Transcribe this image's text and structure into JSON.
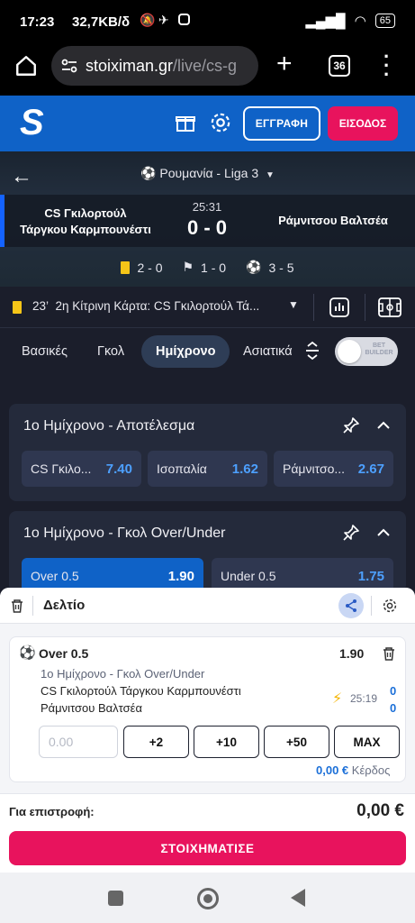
{
  "status_bar": {
    "time": "17:23",
    "speed": "32,7KB/δ",
    "battery": "65"
  },
  "browser": {
    "host": "stoiximan.gr",
    "path": "/live/cs-g",
    "tab_count": "36"
  },
  "header": {
    "logo": "S",
    "register_label": "ΕΓΓΡΑΦΗ",
    "login_label": "ΕΙΣΟΔΟΣ"
  },
  "match": {
    "league": "Ρουμανία - Liga 3",
    "home_team_line1": "CS Γκιλορτούλ",
    "home_team_line2": "Τάργκου Καρμπουνέστι",
    "away_team": "Ράμνιτσου Βαλτσέα",
    "clock": "25:31",
    "score": "0 - 0",
    "stats": {
      "yellow_cards": "2 - 0",
      "corners": "1 - 0",
      "shots": "3 - 5"
    }
  },
  "event": {
    "minute": "23’",
    "text": "2η Κίτρινη Κάρτα: CS Γκιλορτούλ Τά..."
  },
  "tabs": [
    "Βασικές",
    "Γκολ",
    "Ημίχρονο",
    "Ασιατικά"
  ],
  "active_tab": "Ημίχρονο",
  "bet_builder": {
    "line1": "BET",
    "line2": "BUILDER"
  },
  "markets": [
    {
      "title": "1ο Ημίχρονο - Αποτέλεσμα",
      "odds": [
        {
          "label": "CS Γκιλο...",
          "value": "7.40"
        },
        {
          "label": "Ισοπαλία",
          "value": "1.62"
        },
        {
          "label": "Ράμνιτσο...",
          "value": "2.67"
        }
      ]
    },
    {
      "title": "1ο Ημίχρονο - Γκολ Over/Under",
      "odds": [
        {
          "label": "Over 0.5",
          "value": "1.90",
          "selected": true
        },
        {
          "label": "Under 0.5",
          "value": "1.75"
        }
      ]
    }
  ],
  "slip": {
    "title": "Δελτίο",
    "selection": "Over 0.5",
    "odd": "1.90",
    "market": "1ο Ημίχρονο - Γκολ Over/Under",
    "team1": "CS Γκιλορτούλ Τάργκου Καρμπουνέστι",
    "team2": "Ράμνιτσου Βαλτσέα",
    "time": "25:19",
    "score1": "0",
    "score2": "0",
    "stake_placeholder": "0.00",
    "quick_amounts": [
      "+2",
      "+10",
      "+50",
      "MAX"
    ],
    "winnings_amount": "0,00 €",
    "winnings_label": "Κέρδος",
    "return_label": "Για επιστροφή:",
    "return_value": "0,00 €",
    "place_bet_label": "ΣΤΟΙΧΗΜΑΤΙΣΕ"
  },
  "colors": {
    "brand_blue": "#0f62c7",
    "accent_pink": "#e8135d",
    "odd_blue": "#4da0ff",
    "card_yellow": "#f5c518"
  }
}
